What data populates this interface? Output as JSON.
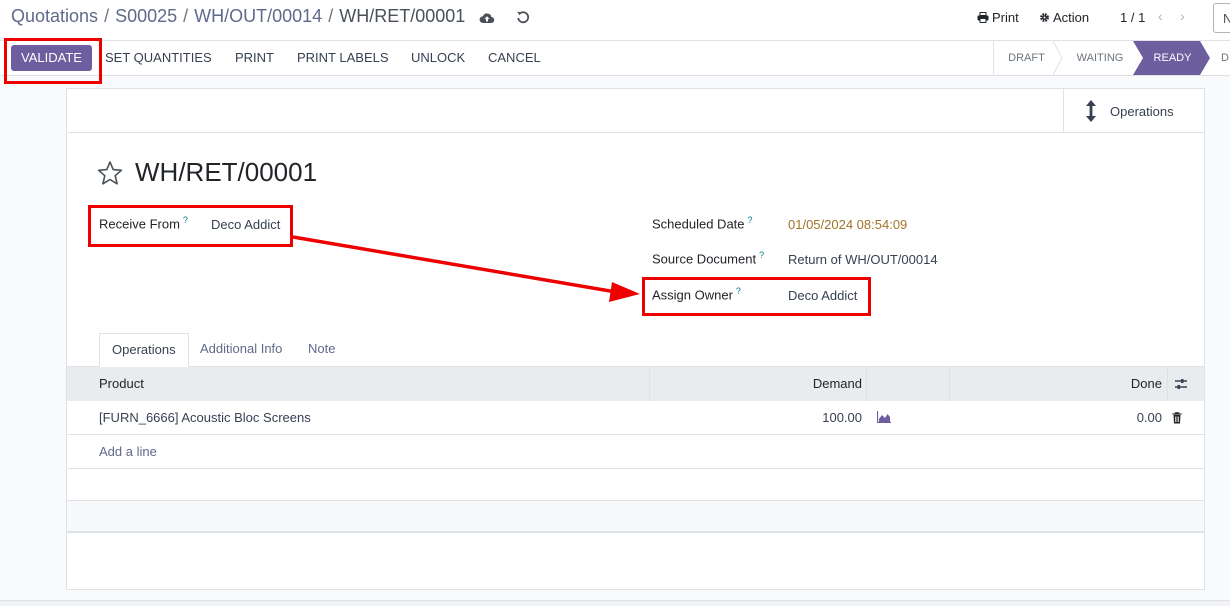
{
  "breadcrumb": {
    "items": [
      "Quotations",
      "S00025",
      "WH/OUT/00014"
    ],
    "separator": "/",
    "current": "WH/RET/00001"
  },
  "topbar": {
    "print_label": "Print",
    "action_label": "Action",
    "pager": "1 / 1",
    "new_label": "N"
  },
  "actions": {
    "validate": "VALIDATE",
    "set_quantities": "SET QUANTITIES",
    "print": "PRINT",
    "print_labels": "PRINT LABELS",
    "unlock": "UNLOCK",
    "cancel": "CANCEL"
  },
  "statusbar": {
    "draft": "DRAFT",
    "waiting": "WAITING",
    "ready": "READY",
    "done_partial": "D"
  },
  "smart_button": {
    "label": "Operations"
  },
  "record": {
    "title": "WH/RET/00001",
    "receive_from_label": "Receive From",
    "receive_from_value": "Deco Addict",
    "scheduled_date_label": "Scheduled Date",
    "scheduled_date_value": "01/05/2024 08:54:09",
    "source_document_label": "Source Document",
    "source_document_value": "Return of WH/OUT/00014",
    "assign_owner_label": "Assign Owner",
    "assign_owner_value": "Deco Addict",
    "help_mark": "?"
  },
  "tabs": [
    "Operations",
    "Additional Info",
    "Note"
  ],
  "table": {
    "headers": {
      "product": "Product",
      "demand": "Demand",
      "done": "Done"
    },
    "rows": [
      {
        "product": "[FURN_6666] Acoustic Bloc Screens",
        "demand": "100.00",
        "done": "0.00"
      }
    ],
    "add_line": "Add a line"
  },
  "colors": {
    "primary": "#6c5e9f",
    "link": "#5f6a8a",
    "annotation": "#ee0000",
    "date": "#a07428"
  }
}
